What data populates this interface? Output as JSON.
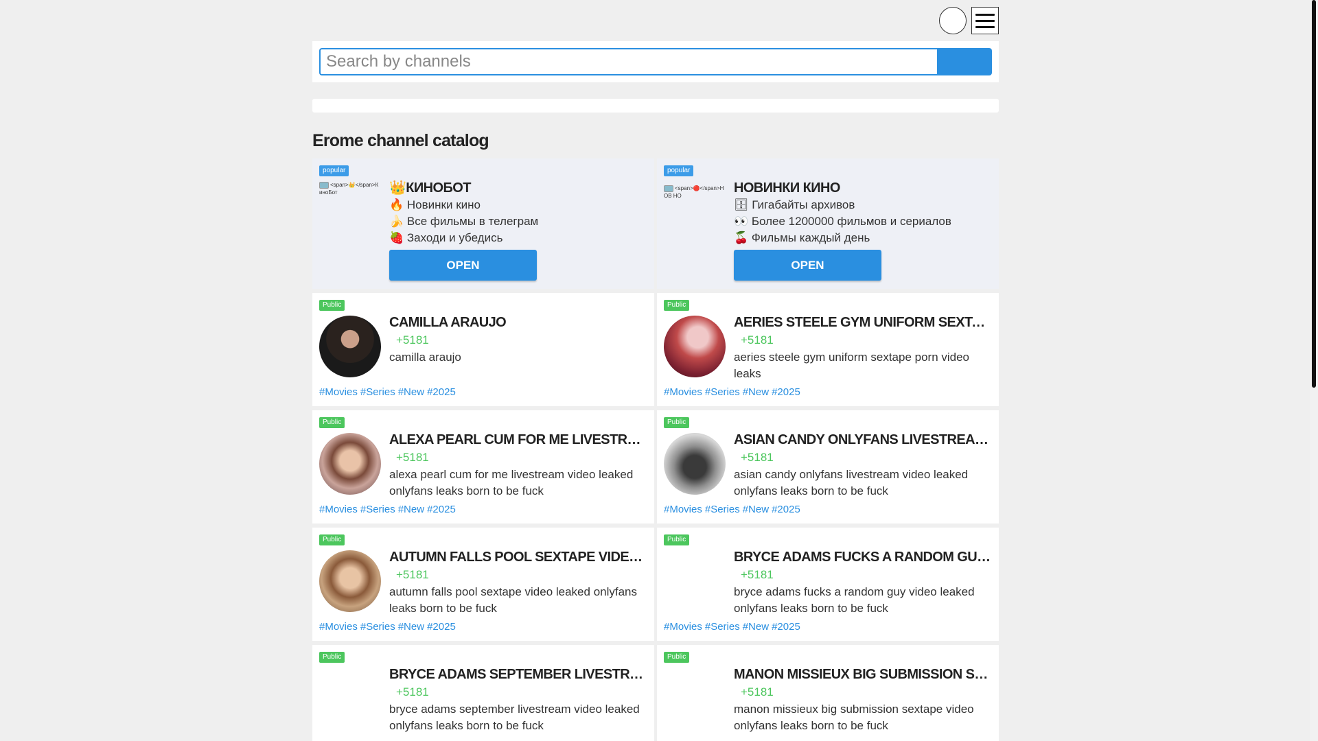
{
  "search": {
    "placeholder": "Search by channels"
  },
  "page_title": "Erome channel catalog",
  "promos": [
    {
      "badge": "popular",
      "avatar_alt": "<span>👑</span>КиноБот",
      "title": "👑КИНОБОТ",
      "lines": [
        "🔥 Новинки кино",
        "🍌 Все фильмы в телеграм",
        "🍓 Заходи и убедись"
      ],
      "button": "OPEN"
    },
    {
      "badge": "popular",
      "avatar_alt": "<span>🔴</span>НОВ НО",
      "title": "НОВИНКИ КИНО",
      "lines": [
        "🗄 Гигабайты архивов",
        "👀 Более 1200000 фильмов и сериалов",
        "🍒 Фильмы каждый день"
      ],
      "button": "OPEN"
    }
  ],
  "channels": [
    {
      "badge": "Public",
      "title": "CAMILLA ARAUJO",
      "count": "+5181",
      "desc": "camilla araujo",
      "avatar": "dark"
    },
    {
      "badge": "Public",
      "title": "AERIES STEELE GYM UNIFORM SEXTAPE PORN VIDEO LEAKS",
      "count": "+5181",
      "desc": "aeries steele gym uniform sextape porn video leaks",
      "avatar": "red"
    },
    {
      "badge": "Public",
      "title": "ALEXA PEARL CUM FOR ME LIVESTREAM VIDEO LEAKED",
      "count": "+5181",
      "desc": "alexa pearl cum for me livestream video leaked onlyfans leaks born to be fuck",
      "avatar": "warm"
    },
    {
      "badge": "Public",
      "title": "ASIAN CANDY ONLYFANS LIVESTREAM VIDEO LEAKED",
      "count": "+5181",
      "desc": "asian candy onlyfans livestream video leaked onlyfans leaks born to be fuck",
      "avatar": "gray"
    },
    {
      "badge": "Public",
      "title": "AUTUMN FALLS POOL SEXTAPE VIDEO LEAKED",
      "count": "+5181",
      "desc": "autumn falls pool sextape video leaked onlyfans leaks born to be fuck",
      "avatar": "brown"
    },
    {
      "badge": "Public",
      "title": "BRYCE ADAMS FUCKS A RANDOM GUY VIDEO LEAKED",
      "count": "+5181",
      "desc": "bryce adams fucks a random guy video leaked onlyfans leaks born to be fuck",
      "avatar": "none"
    },
    {
      "badge": "Public",
      "title": "BRYCE ADAMS SEPTEMBER LIVESTREAM VIDEO LEAKED",
      "count": "+5181",
      "desc": "bryce adams september livestream video leaked onlyfans leaks born to be fuck",
      "avatar": "none"
    },
    {
      "badge": "Public",
      "title": "MANON MISSIEUX BIG SUBMISSION SEXTAPE VIDEO",
      "count": "+5181",
      "desc": "manon missieux big submission sextape video onlyfans leaks born to be fuck",
      "avatar": "none"
    }
  ],
  "tags": [
    "#Movies",
    "#Series",
    "#New",
    "#2025"
  ],
  "colors": {
    "accent": "#2a8fe0",
    "public_badge": "#4cc65d",
    "popular_badge": "#3c9ce8",
    "count": "#4cc65d"
  }
}
